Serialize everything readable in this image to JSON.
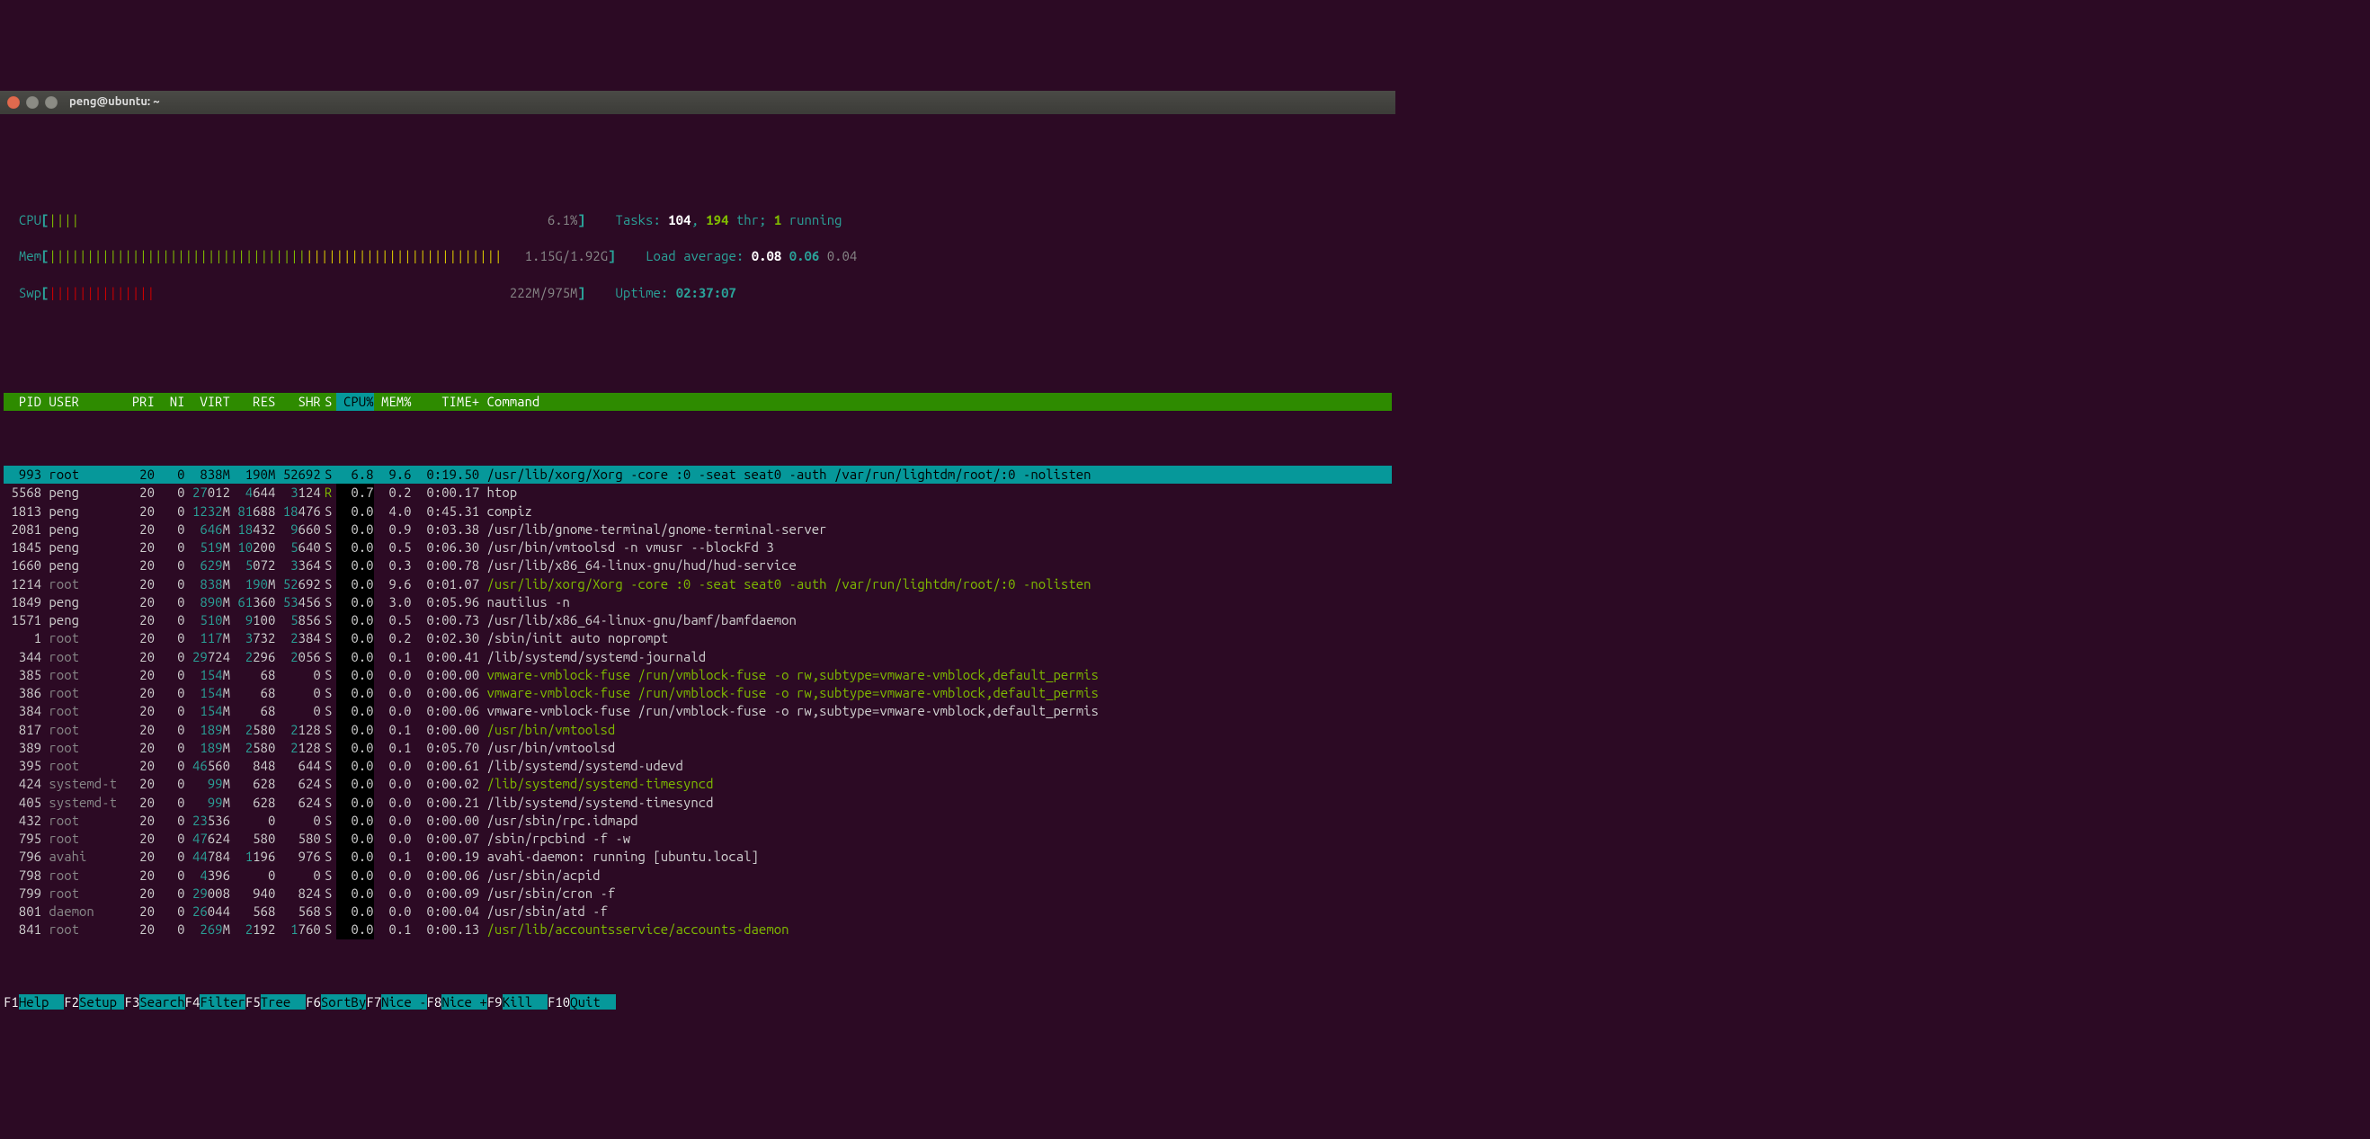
{
  "window": {
    "title": "peng@ubuntu: ~"
  },
  "meters": {
    "cpu": {
      "label": "CPU",
      "bar": "||||",
      "value": "6.1%"
    },
    "mem": {
      "label": "Mem",
      "bar_green": "||||||||||||||||||||||||||||||||||",
      "bar_yellow": "||||||||||||||||||||||||||",
      "value_used": "1.15G",
      "value_total": "1.92G"
    },
    "swp": {
      "label": "Swp",
      "bar_red": "||||||||||||||",
      "value_used": "222M",
      "value_total": "975M"
    }
  },
  "stats": {
    "tasks_label": "Tasks:",
    "tasks": "104",
    "thr": "194",
    "thr_label": "thr;",
    "running": "1",
    "running_label": "running",
    "load_label": "Load average:",
    "load1": "0.08",
    "load5": "0.06",
    "load15": "0.04",
    "uptime_label": "Uptime:",
    "uptime": "02:37:07"
  },
  "columns": {
    "pid": "PID",
    "user": "USER",
    "pri": "PRI",
    "ni": "NI",
    "virt": "VIRT",
    "res": "RES",
    "shr": "SHR",
    "s": "S",
    "cpu": "CPU%",
    "mem": "MEM%",
    "time": "TIME+",
    "cmd": "Command"
  },
  "processes": [
    {
      "pid": "993",
      "user": "root",
      "pri": "20",
      "ni": "0",
      "virt": "838M",
      "res": "190M",
      "shr": "52692",
      "s": "S",
      "cpu": "6.8",
      "mem": "9.6",
      "time": "0:19.50",
      "cmd": "/usr/lib/xorg/Xorg -core :0 -seat seat0 -auth /var/run/lightdm/root/:0 -nolisten",
      "selected": true,
      "highlight": false,
      "dimuser": true
    },
    {
      "pid": "5568",
      "user": "peng",
      "pri": "20",
      "ni": "0",
      "virt": "27012",
      "res": "4644",
      "shr": "3124",
      "s": "R",
      "cpu": "0.7",
      "mem": "0.2",
      "time": "0:00.17",
      "cmd": "htop",
      "selected": false,
      "highlight": false,
      "dimuser": false
    },
    {
      "pid": "1813",
      "user": "peng",
      "pri": "20",
      "ni": "0",
      "virt": "1232M",
      "res": "81688",
      "shr": "18476",
      "s": "S",
      "cpu": "0.0",
      "mem": "4.0",
      "time": "0:45.31",
      "cmd": "compiz",
      "selected": false,
      "highlight": false,
      "dimuser": false
    },
    {
      "pid": "2081",
      "user": "peng",
      "pri": "20",
      "ni": "0",
      "virt": "646M",
      "res": "18432",
      "shr": "9660",
      "s": "S",
      "cpu": "0.0",
      "mem": "0.9",
      "time": "0:03.38",
      "cmd": "/usr/lib/gnome-terminal/gnome-terminal-server",
      "selected": false,
      "highlight": false,
      "dimuser": false
    },
    {
      "pid": "1845",
      "user": "peng",
      "pri": "20",
      "ni": "0",
      "virt": "519M",
      "res": "10200",
      "shr": "5640",
      "s": "S",
      "cpu": "0.0",
      "mem": "0.5",
      "time": "0:06.30",
      "cmd": "/usr/bin/vmtoolsd -n vmusr --blockFd 3",
      "selected": false,
      "highlight": false,
      "dimuser": false
    },
    {
      "pid": "1660",
      "user": "peng",
      "pri": "20",
      "ni": "0",
      "virt": "629M",
      "res": "5072",
      "shr": "3364",
      "s": "S",
      "cpu": "0.0",
      "mem": "0.3",
      "time": "0:00.78",
      "cmd": "/usr/lib/x86_64-linux-gnu/hud/hud-service",
      "selected": false,
      "highlight": false,
      "dimuser": false
    },
    {
      "pid": "1214",
      "user": "root",
      "pri": "20",
      "ni": "0",
      "virt": "838M",
      "res": "190M",
      "shr": "52692",
      "s": "S",
      "cpu": "0.0",
      "mem": "9.6",
      "time": "0:01.07",
      "cmd": "/usr/lib/xorg/Xorg -core :0 -seat seat0 -auth /var/run/lightdm/root/:0 -nolisten",
      "selected": false,
      "highlight": true,
      "dimuser": true
    },
    {
      "pid": "1849",
      "user": "peng",
      "pri": "20",
      "ni": "0",
      "virt": "890M",
      "res": "61360",
      "shr": "53456",
      "s": "S",
      "cpu": "0.0",
      "mem": "3.0",
      "time": "0:05.96",
      "cmd": "nautilus -n",
      "selected": false,
      "highlight": false,
      "dimuser": false
    },
    {
      "pid": "1571",
      "user": "peng",
      "pri": "20",
      "ni": "0",
      "virt": "510M",
      "res": "9100",
      "shr": "5856",
      "s": "S",
      "cpu": "0.0",
      "mem": "0.5",
      "time": "0:00.73",
      "cmd": "/usr/lib/x86_64-linux-gnu/bamf/bamfdaemon",
      "selected": false,
      "highlight": false,
      "dimuser": false
    },
    {
      "pid": "1",
      "user": "root",
      "pri": "20",
      "ni": "0",
      "virt": "117M",
      "res": "3732",
      "shr": "2384",
      "s": "S",
      "cpu": "0.0",
      "mem": "0.2",
      "time": "0:02.30",
      "cmd": "/sbin/init auto noprompt",
      "selected": false,
      "highlight": false,
      "dimuser": true
    },
    {
      "pid": "344",
      "user": "root",
      "pri": "20",
      "ni": "0",
      "virt": "29724",
      "res": "2296",
      "shr": "2056",
      "s": "S",
      "cpu": "0.0",
      "mem": "0.1",
      "time": "0:00.41",
      "cmd": "/lib/systemd/systemd-journald",
      "selected": false,
      "highlight": false,
      "dimuser": true
    },
    {
      "pid": "385",
      "user": "root",
      "pri": "20",
      "ni": "0",
      "virt": "154M",
      "res": "68",
      "shr": "0",
      "s": "S",
      "cpu": "0.0",
      "mem": "0.0",
      "time": "0:00.00",
      "cmd": "vmware-vmblock-fuse /run/vmblock-fuse -o rw,subtype=vmware-vmblock,default_permis",
      "selected": false,
      "highlight": true,
      "dimuser": true
    },
    {
      "pid": "386",
      "user": "root",
      "pri": "20",
      "ni": "0",
      "virt": "154M",
      "res": "68",
      "shr": "0",
      "s": "S",
      "cpu": "0.0",
      "mem": "0.0",
      "time": "0:00.06",
      "cmd": "vmware-vmblock-fuse /run/vmblock-fuse -o rw,subtype=vmware-vmblock,default_permis",
      "selected": false,
      "highlight": true,
      "dimuser": true
    },
    {
      "pid": "384",
      "user": "root",
      "pri": "20",
      "ni": "0",
      "virt": "154M",
      "res": "68",
      "shr": "0",
      "s": "S",
      "cpu": "0.0",
      "mem": "0.0",
      "time": "0:00.06",
      "cmd": "vmware-vmblock-fuse /run/vmblock-fuse -o rw,subtype=vmware-vmblock,default_permis",
      "selected": false,
      "highlight": false,
      "dimuser": true
    },
    {
      "pid": "817",
      "user": "root",
      "pri": "20",
      "ni": "0",
      "virt": "189M",
      "res": "2580",
      "shr": "2128",
      "s": "S",
      "cpu": "0.0",
      "mem": "0.1",
      "time": "0:00.00",
      "cmd": "/usr/bin/vmtoolsd",
      "selected": false,
      "highlight": true,
      "dimuser": true
    },
    {
      "pid": "389",
      "user": "root",
      "pri": "20",
      "ni": "0",
      "virt": "189M",
      "res": "2580",
      "shr": "2128",
      "s": "S",
      "cpu": "0.0",
      "mem": "0.1",
      "time": "0:05.70",
      "cmd": "/usr/bin/vmtoolsd",
      "selected": false,
      "highlight": false,
      "dimuser": true
    },
    {
      "pid": "395",
      "user": "root",
      "pri": "20",
      "ni": "0",
      "virt": "46560",
      "res": "848",
      "shr": "644",
      "s": "S",
      "cpu": "0.0",
      "mem": "0.0",
      "time": "0:00.61",
      "cmd": "/lib/systemd/systemd-udevd",
      "selected": false,
      "highlight": false,
      "dimuser": true
    },
    {
      "pid": "424",
      "user": "systemd-t",
      "pri": "20",
      "ni": "0",
      "virt": "99M",
      "res": "628",
      "shr": "624",
      "s": "S",
      "cpu": "0.0",
      "mem": "0.0",
      "time": "0:00.02",
      "cmd": "/lib/systemd/systemd-timesyncd",
      "selected": false,
      "highlight": true,
      "dimuser": true
    },
    {
      "pid": "405",
      "user": "systemd-t",
      "pri": "20",
      "ni": "0",
      "virt": "99M",
      "res": "628",
      "shr": "624",
      "s": "S",
      "cpu": "0.0",
      "mem": "0.0",
      "time": "0:00.21",
      "cmd": "/lib/systemd/systemd-timesyncd",
      "selected": false,
      "highlight": false,
      "dimuser": true
    },
    {
      "pid": "432",
      "user": "root",
      "pri": "20",
      "ni": "0",
      "virt": "23536",
      "res": "0",
      "shr": "0",
      "s": "S",
      "cpu": "0.0",
      "mem": "0.0",
      "time": "0:00.00",
      "cmd": "/usr/sbin/rpc.idmapd",
      "selected": false,
      "highlight": false,
      "dimuser": true
    },
    {
      "pid": "795",
      "user": "root",
      "pri": "20",
      "ni": "0",
      "virt": "47624",
      "res": "580",
      "shr": "580",
      "s": "S",
      "cpu": "0.0",
      "mem": "0.0",
      "time": "0:00.07",
      "cmd": "/sbin/rpcbind -f -w",
      "selected": false,
      "highlight": false,
      "dimuser": true
    },
    {
      "pid": "796",
      "user": "avahi",
      "pri": "20",
      "ni": "0",
      "virt": "44784",
      "res": "1196",
      "shr": "976",
      "s": "S",
      "cpu": "0.0",
      "mem": "0.1",
      "time": "0:00.19",
      "cmd": "avahi-daemon: running [ubuntu.local]",
      "selected": false,
      "highlight": false,
      "dimuser": true
    },
    {
      "pid": "798",
      "user": "root",
      "pri": "20",
      "ni": "0",
      "virt": "4396",
      "res": "0",
      "shr": "0",
      "s": "S",
      "cpu": "0.0",
      "mem": "0.0",
      "time": "0:00.06",
      "cmd": "/usr/sbin/acpid",
      "selected": false,
      "highlight": false,
      "dimuser": true
    },
    {
      "pid": "799",
      "user": "root",
      "pri": "20",
      "ni": "0",
      "virt": "29008",
      "res": "940",
      "shr": "824",
      "s": "S",
      "cpu": "0.0",
      "mem": "0.0",
      "time": "0:00.09",
      "cmd": "/usr/sbin/cron -f",
      "selected": false,
      "highlight": false,
      "dimuser": true
    },
    {
      "pid": "801",
      "user": "daemon",
      "pri": "20",
      "ni": "0",
      "virt": "26044",
      "res": "568",
      "shr": "568",
      "s": "S",
      "cpu": "0.0",
      "mem": "0.0",
      "time": "0:00.04",
      "cmd": "/usr/sbin/atd -f",
      "selected": false,
      "highlight": false,
      "dimuser": true
    },
    {
      "pid": "841",
      "user": "root",
      "pri": "20",
      "ni": "0",
      "virt": "269M",
      "res": "2192",
      "shr": "1760",
      "s": "S",
      "cpu": "0.0",
      "mem": "0.1",
      "time": "0:00.13",
      "cmd": "/usr/lib/accountsservice/accounts-daemon",
      "selected": false,
      "highlight": true,
      "dimuser": true
    }
  ],
  "footer": [
    {
      "key": "F1",
      "label": "Help  "
    },
    {
      "key": "F2",
      "label": "Setup "
    },
    {
      "key": "F3",
      "label": "Search"
    },
    {
      "key": "F4",
      "label": "Filter"
    },
    {
      "key": "F5",
      "label": "Tree  "
    },
    {
      "key": "F6",
      "label": "SortBy"
    },
    {
      "key": "F7",
      "label": "Nice -"
    },
    {
      "key": "F8",
      "label": "Nice +"
    },
    {
      "key": "F9",
      "label": "Kill  "
    },
    {
      "key": "F10",
      "label": "Quit  "
    }
  ]
}
